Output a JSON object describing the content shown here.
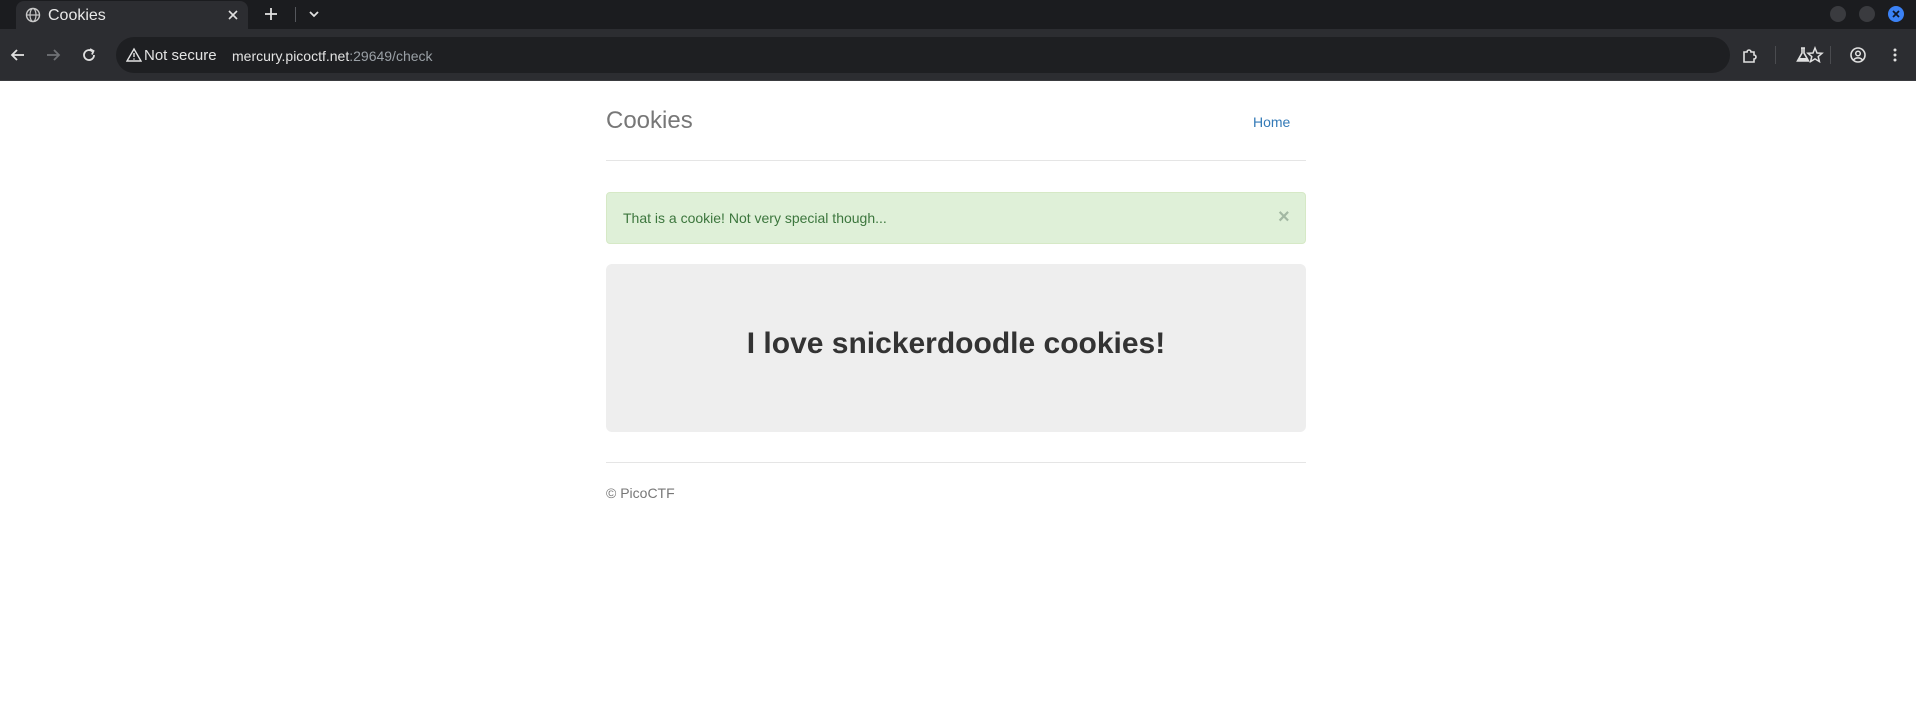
{
  "browser": {
    "tab": {
      "title": "Cookies",
      "favicon": "globe-icon"
    },
    "toolbar": {
      "security_label": "Not secure",
      "url_host": "mercury.picoctf.net",
      "url_rest": ":29649/check"
    },
    "accent_color": "#3b82f6"
  },
  "page": {
    "brand": "Cookies",
    "nav": {
      "home_label": "Home"
    },
    "alert": {
      "message": "That is a cookie! Not very special though...",
      "close_glyph": "×",
      "color": "#dff0d8"
    },
    "jumbotron": {
      "heading": "I love snickerdoodle cookies!"
    },
    "footer": {
      "text": "© PicoCTF"
    }
  }
}
